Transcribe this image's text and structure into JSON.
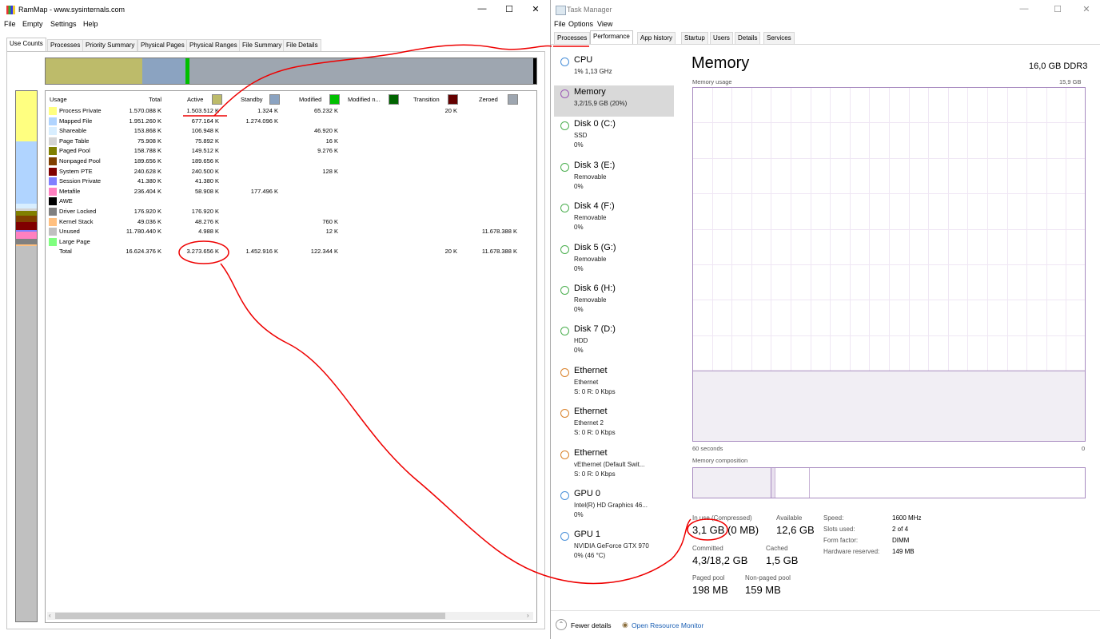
{
  "rammap": {
    "title": "RamMap - www.sysinternals.com",
    "menu": [
      "File",
      "Empty",
      "Settings",
      "Help"
    ],
    "tabs": [
      "Use Counts",
      "Processes",
      "Priority Summary",
      "Physical Pages",
      "Physical Ranges",
      "File Summary",
      "File Details"
    ],
    "columns": {
      "usage": "Usage",
      "total": "Total",
      "active": "Active",
      "standby": "Standby",
      "modified": "Modified",
      "modified_nw": "Modified n...",
      "transition": "Transition",
      "zeroed": "Zeroed"
    },
    "column_colors": {
      "active": "#bdbb6a",
      "standby": "#8ba3c1",
      "modified": "#00c000",
      "modified_nw": "#006400",
      "transition": "#640000",
      "zeroed": "#9ea6b0"
    },
    "rows": [
      {
        "name": "Process Private",
        "color": "#ffff80",
        "total": "1.570.088 K",
        "active": "1.503.512 K",
        "standby": "1.324 K",
        "modified": "65.232 K",
        "modified_nw": "",
        "transition": "20 K",
        "zeroed": ""
      },
      {
        "name": "Mapped File",
        "color": "#b0d4ff",
        "total": "1.951.260 K",
        "active": "677.164 K",
        "standby": "1.274.096 K",
        "modified": "",
        "modified_nw": "",
        "transition": "",
        "zeroed": ""
      },
      {
        "name": "Shareable",
        "color": "#d8eeff",
        "total": "153.868 K",
        "active": "106.948 K",
        "standby": "",
        "modified": "46.920 K",
        "modified_nw": "",
        "transition": "",
        "zeroed": ""
      },
      {
        "name": "Page Table",
        "color": "#d4d4d4",
        "total": "75.908 K",
        "active": "75.892 K",
        "standby": "",
        "modified": "16 K",
        "modified_nw": "",
        "transition": "",
        "zeroed": ""
      },
      {
        "name": "Paged Pool",
        "color": "#808000",
        "total": "158.788 K",
        "active": "149.512 K",
        "standby": "",
        "modified": "9.276 K",
        "modified_nw": "",
        "transition": "",
        "zeroed": ""
      },
      {
        "name": "Nonpaged Pool",
        "color": "#804000",
        "total": "189.656 K",
        "active": "189.656 K",
        "standby": "",
        "modified": "",
        "modified_nw": "",
        "transition": "",
        "zeroed": ""
      },
      {
        "name": "System PTE",
        "color": "#800000",
        "total": "240.628 K",
        "active": "240.500 K",
        "standby": "",
        "modified": "128 K",
        "modified_nw": "",
        "transition": "",
        "zeroed": ""
      },
      {
        "name": "Session Private",
        "color": "#8080ff",
        "total": "41.380 K",
        "active": "41.380 K",
        "standby": "",
        "modified": "",
        "modified_nw": "",
        "transition": "",
        "zeroed": ""
      },
      {
        "name": "Metafile",
        "color": "#ff80c0",
        "total": "236.404 K",
        "active": "58.908 K",
        "standby": "177.496 K",
        "modified": "",
        "modified_nw": "",
        "transition": "",
        "zeroed": ""
      },
      {
        "name": "AWE",
        "color": "#000000",
        "total": "",
        "active": "",
        "standby": "",
        "modified": "",
        "modified_nw": "",
        "transition": "",
        "zeroed": ""
      },
      {
        "name": "Driver Locked",
        "color": "#808080",
        "total": "176.920 K",
        "active": "176.920 K",
        "standby": "",
        "modified": "",
        "modified_nw": "",
        "transition": "",
        "zeroed": ""
      },
      {
        "name": "Kernel Stack",
        "color": "#ffc080",
        "total": "49.036 K",
        "active": "48.276 K",
        "standby": "",
        "modified": "760 K",
        "modified_nw": "",
        "transition": "",
        "zeroed": ""
      },
      {
        "name": "Unused",
        "color": "#c0c0c0",
        "total": "11.780.440 K",
        "active": "4.988 K",
        "standby": "",
        "modified": "12 K",
        "modified_nw": "",
        "transition": "",
        "zeroed": "11.678.388 K"
      },
      {
        "name": "Large Page",
        "color": "#80ff80",
        "total": "",
        "active": "",
        "standby": "",
        "modified": "",
        "modified_nw": "",
        "transition": "",
        "zeroed": ""
      },
      {
        "name": "Total",
        "color": "",
        "total": "16.624.376 K",
        "active": "3.273.656 K",
        "standby": "1.452.916 K",
        "modified": "122.344 K",
        "modified_nw": "",
        "transition": "20 K",
        "zeroed": "11.678.388 K"
      }
    ]
  },
  "taskmgr": {
    "title": "Task Manager",
    "menu": [
      "File",
      "Options",
      "View"
    ],
    "tabs": [
      "Processes",
      "Performance",
      "App history",
      "Startup",
      "Users",
      "Details",
      "Services"
    ],
    "sidebar": [
      {
        "name": "CPU",
        "sub1": "1% 1,13 GHz",
        "sub2": "",
        "sub3": "",
        "color": "#4a90d9"
      },
      {
        "name": "Memory",
        "sub1": "3,2/15,9 GB (20%)",
        "sub2": "",
        "sub3": "",
        "color": "#9b59b6"
      },
      {
        "name": "Disk 0 (C:)",
        "sub1": "SSD",
        "sub2": "0%",
        "sub3": "",
        "color": "#4caf50"
      },
      {
        "name": "Disk 3 (E:)",
        "sub1": "Removable",
        "sub2": "0%",
        "sub3": "",
        "color": "#4caf50"
      },
      {
        "name": "Disk 4 (F:)",
        "sub1": "Removable",
        "sub2": "0%",
        "sub3": "",
        "color": "#4caf50"
      },
      {
        "name": "Disk 5 (G:)",
        "sub1": "Removable",
        "sub2": "0%",
        "sub3": "",
        "color": "#4caf50"
      },
      {
        "name": "Disk 6 (H:)",
        "sub1": "Removable",
        "sub2": "0%",
        "sub3": "",
        "color": "#4caf50"
      },
      {
        "name": "Disk 7 (D:)",
        "sub1": "HDD",
        "sub2": "0%",
        "sub3": "",
        "color": "#4caf50"
      },
      {
        "name": "Ethernet",
        "sub1": "Ethernet",
        "sub2": "S: 0 R: 0 Kbps",
        "sub3": "",
        "color": "#d9822b"
      },
      {
        "name": "Ethernet",
        "sub1": "Ethernet 2",
        "sub2": "S: 0 R: 0 Kbps",
        "sub3": "",
        "color": "#d9822b"
      },
      {
        "name": "Ethernet",
        "sub1": "vEthernet (Default Swit...",
        "sub2": "S: 0 R: 0 Kbps",
        "sub3": "",
        "color": "#d9822b"
      },
      {
        "name": "GPU 0",
        "sub1": "Intel(R) HD Graphics 46...",
        "sub2": "0%",
        "sub3": "",
        "color": "#4a90d9"
      },
      {
        "name": "GPU 1",
        "sub1": "NVIDIA GeForce GTX 970",
        "sub2": "0% (46 °C)",
        "sub3": "",
        "color": "#4a90d9"
      }
    ],
    "main": {
      "heading": "Memory",
      "capacity": "16,0 GB DDR3",
      "usage_label": "Memory usage",
      "usage_max": "15,9 GB",
      "time_label": "60 seconds",
      "zero_label": "0",
      "usage_fraction": 0.2,
      "composition_label": "Memory composition",
      "in_use_label": "In use (Compressed)",
      "in_use_value": "3,1 GB (0 MB)",
      "available_label": "Available",
      "available_value": "12,6 GB",
      "committed_label": "Committed",
      "committed_value": "4,3/18,2 GB",
      "cached_label": "Cached",
      "cached_value": "1,5 GB",
      "paged_label": "Paged pool",
      "paged_value": "198 MB",
      "nonpaged_label": "Non-paged pool",
      "nonpaged_value": "159 MB",
      "speed_label": "Speed:",
      "speed_value": "1600 MHz",
      "slots_label": "Slots used:",
      "slots_value": "2 of 4",
      "form_label": "Form factor:",
      "form_value": "DIMM",
      "reserved_label": "Hardware reserved:",
      "reserved_value": "149 MB"
    },
    "footer": {
      "fewer": "Fewer details",
      "monitor": "Open Resource Monitor"
    }
  }
}
